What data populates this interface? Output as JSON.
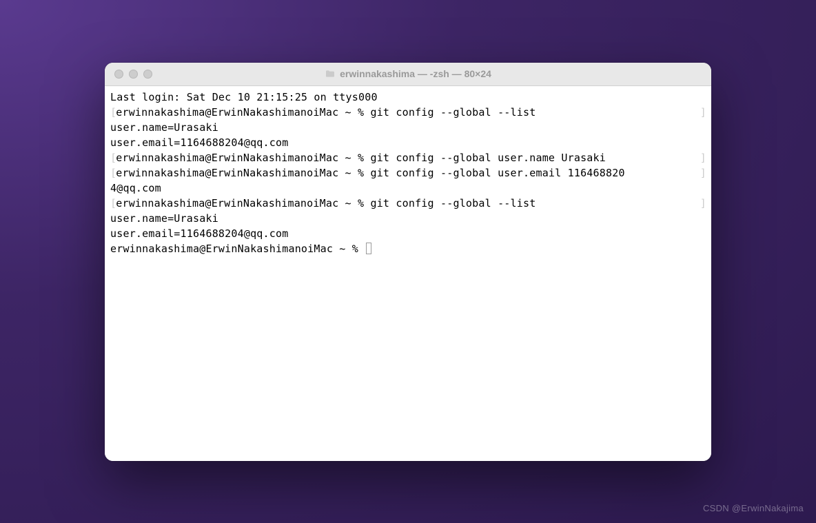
{
  "window": {
    "title": "erwinnakashima — -zsh — 80×24"
  },
  "terminal": {
    "lines": [
      {
        "text": "Last login: Sat Dec 10 21:15:25 on ttys000",
        "bracket": false
      },
      {
        "text": "erwinnakashima@ErwinNakashimanoiMac ~ % git config --global --list",
        "bracket": true
      },
      {
        "text": "user.name=Urasaki",
        "bracket": false
      },
      {
        "text": "user.email=1164688204@qq.com",
        "bracket": false
      },
      {
        "text": "erwinnakashima@ErwinNakashimanoiMac ~ % git config --global user.name Urasaki",
        "bracket": true
      },
      {
        "text": "erwinnakashima@ErwinNakashimanoiMac ~ % git config --global user.email 116468820",
        "bracket": true
      },
      {
        "text": "4@qq.com",
        "bracket": false
      },
      {
        "text": "erwinnakashima@ErwinNakashimanoiMac ~ % git config --global --list",
        "bracket": true
      },
      {
        "text": "user.name=Urasaki",
        "bracket": false
      },
      {
        "text": "user.email=1164688204@qq.com",
        "bracket": false
      },
      {
        "text": "erwinnakashima@ErwinNakashimanoiMac ~ % ",
        "bracket": false,
        "cursor": true
      }
    ]
  },
  "watermark": "CSDN @ErwinNakajima"
}
